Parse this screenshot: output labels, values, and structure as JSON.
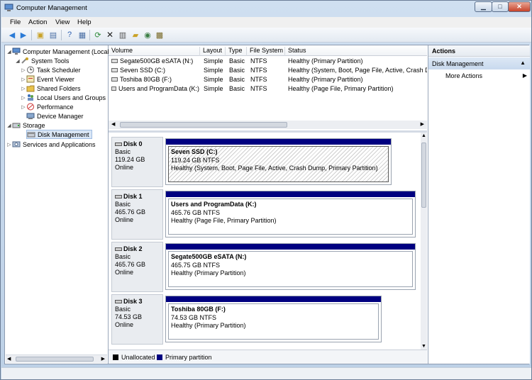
{
  "window": {
    "title": "Computer Management"
  },
  "menu": [
    "File",
    "Action",
    "View",
    "Help"
  ],
  "tree": {
    "root": "Computer Management (Local",
    "system_tools": "System Tools",
    "task_scheduler": "Task Scheduler",
    "event_viewer": "Event Viewer",
    "shared_folders": "Shared Folders",
    "local_users": "Local Users and Groups",
    "performance": "Performance",
    "device_manager": "Device Manager",
    "storage": "Storage",
    "disk_management": "Disk Management",
    "services": "Services and Applications"
  },
  "volume_list": {
    "headers": {
      "volume": "Volume",
      "layout": "Layout",
      "type": "Type",
      "fs": "File System",
      "status": "Status"
    },
    "rows": [
      {
        "volume": "Segate500GB eSATA (N:)",
        "layout": "Simple",
        "type": "Basic",
        "fs": "NTFS",
        "status": "Healthy (Primary Partition)"
      },
      {
        "volume": "Seven SSD (C:)",
        "layout": "Simple",
        "type": "Basic",
        "fs": "NTFS",
        "status": "Healthy (System, Boot, Page File, Active, Crash Du"
      },
      {
        "volume": "Toshiba 80GB (F:)",
        "layout": "Simple",
        "type": "Basic",
        "fs": "NTFS",
        "status": "Healthy (Primary Partition)"
      },
      {
        "volume": "Users and ProgramData (K:)",
        "layout": "Simple",
        "type": "Basic",
        "fs": "NTFS",
        "status": "Healthy (Page File, Primary Partition)"
      }
    ]
  },
  "disks": [
    {
      "name": "Disk 0",
      "type": "Basic",
      "size": "119.24 GB",
      "state": "Online",
      "partition": {
        "name": "Seven SSD  (C:)",
        "size": "119.24 GB NTFS",
        "status": "Healthy (System, Boot, Page File, Active, Crash Dump, Primary Partition)"
      }
    },
    {
      "name": "Disk 1",
      "type": "Basic",
      "size": "465.76 GB",
      "state": "Online",
      "partition": {
        "name": "Users and ProgramData  (K:)",
        "size": "465.76 GB NTFS",
        "status": "Healthy (Page File, Primary Partition)"
      }
    },
    {
      "name": "Disk 2",
      "type": "Basic",
      "size": "465.76 GB",
      "state": "Online",
      "partition": {
        "name": "Segate500GB eSATA  (N:)",
        "size": "465.75 GB NTFS",
        "status": "Healthy (Primary Partition)"
      }
    },
    {
      "name": "Disk 3",
      "type": "Basic",
      "size": "74.53 GB",
      "state": "Online",
      "partition": {
        "name": "Toshiba 80GB  (F:)",
        "size": "74.53 GB NTFS",
        "status": "Healthy (Primary Partition)"
      }
    }
  ],
  "legend": {
    "unallocated": "Unallocated",
    "primary": "Primary partition",
    "unallocated_color": "#000000",
    "primary_color": "#000080"
  },
  "actions": {
    "title": "Actions",
    "section": "Disk Management",
    "more": "More Actions"
  }
}
